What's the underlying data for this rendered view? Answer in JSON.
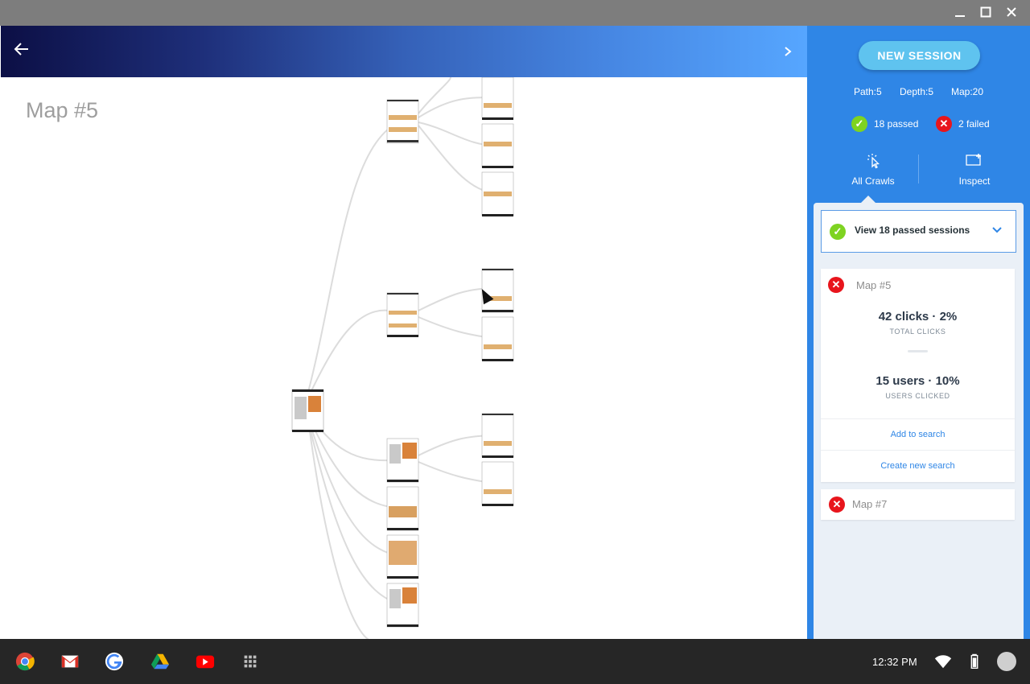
{
  "window": {
    "minimize_icon": "minimize-icon",
    "maximize_icon": "maximize-icon",
    "close_icon": "close-icon"
  },
  "header": {
    "back_icon": "arrow-left-icon",
    "next_icon": "chevron-right-icon",
    "gradient_start": "#0c0f45",
    "gradient_end": "#56a6ff"
  },
  "canvas": {
    "map_title": "Map #5"
  },
  "panel": {
    "accent": "#2f86e6",
    "new_session_label": "NEW SESSION",
    "stats": {
      "path": "Path:5",
      "depth": "Depth:5",
      "map": "Map:20"
    },
    "passed_label": "18 passed",
    "failed_label": "2 failed",
    "passed_color": "#7ed321",
    "failed_color": "#e8151c",
    "tabs": [
      {
        "label": "All Crawls",
        "icon": "pointer-click-icon"
      },
      {
        "label": "Inspect",
        "icon": "add-screen-icon"
      }
    ],
    "passed_sessions_label": "View 18 passed sessions",
    "cards": [
      {
        "name": "Map #5",
        "clicks": "42 clicks · 2%",
        "clicks_caption": "TOTAL CLICKS",
        "users": "15 users · 10%",
        "users_caption": "USERS CLICKED",
        "add_to_search": "Add to search",
        "create_new_search": "Create new search"
      },
      {
        "name": "Map #7"
      }
    ]
  },
  "taskbar": {
    "apps": [
      "chrome-icon",
      "gmail-icon",
      "google-icon",
      "drive-icon",
      "youtube-icon",
      "app-launcher-icon"
    ],
    "time": "12:32 PM",
    "wifi_icon": "wifi-icon",
    "battery_icon": "battery-icon",
    "avatar_icon": "user-avatar"
  }
}
